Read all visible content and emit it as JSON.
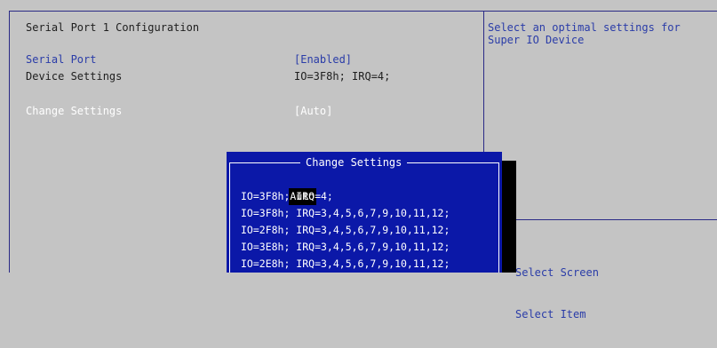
{
  "page": {
    "title": "Serial Port 1 Configuration"
  },
  "settings": [
    {
      "label": "Serial Port",
      "value": "[Enabled]"
    },
    {
      "label": "Device Settings",
      "value": "IO=3F8h; IRQ=4;"
    },
    {
      "label": "Change Settings",
      "value": "[Auto]"
    }
  ],
  "help": {
    "text": "Select an optimal settings for\nSuper IO Device"
  },
  "popup": {
    "title": "Change Settings",
    "options": [
      "Auto",
      "IO=3F8h; IRQ=4;",
      "IO=3F8h; IRQ=3,4,5,6,7,9,10,11,12;",
      "IO=2F8h; IRQ=3,4,5,6,7,9,10,11,12;",
      "IO=3E8h; IRQ=3,4,5,6,7,9,10,11,12;",
      "IO=2E8h; IRQ=3,4,5,6,7,9,10,11,12;"
    ],
    "selected_index": 0
  },
  "keys": [
    "Select Screen",
    "Select Item"
  ],
  "colors": {
    "background": "#c4c4c4",
    "popup_background": "#0b18a8",
    "accent_text": "#2a3ca8",
    "frame_line": "#2a2a86"
  }
}
